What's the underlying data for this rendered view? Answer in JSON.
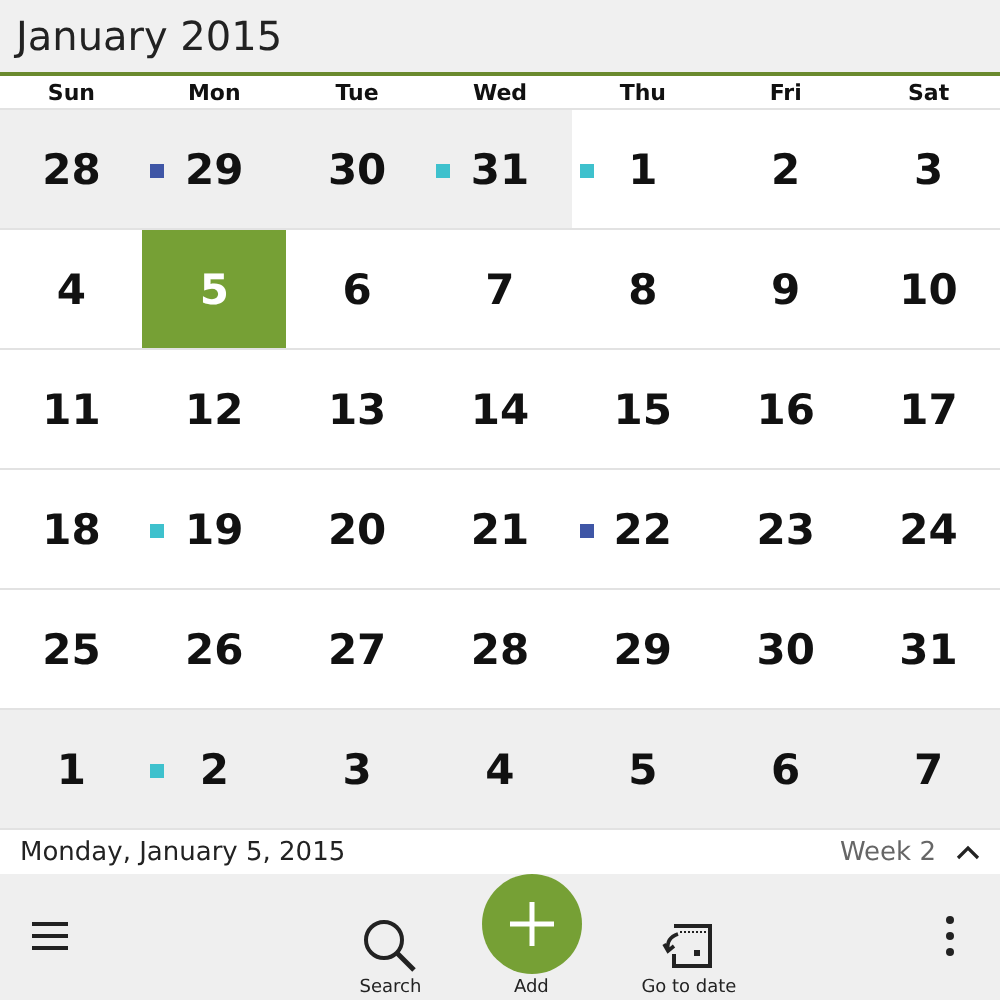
{
  "header": {
    "title": "January 2015"
  },
  "weekdays": [
    "Sun",
    "Mon",
    "Tue",
    "Wed",
    "Thu",
    "Fri",
    "Sat"
  ],
  "weeks": [
    [
      {
        "day": "28",
        "out_of_month": true,
        "selected": false
      },
      {
        "day": "29",
        "out_of_month": true,
        "selected": false,
        "color": "#3f56a6"
      },
      {
        "day": "30",
        "out_of_month": true,
        "selected": false
      },
      {
        "day": "31",
        "out_of_month": true,
        "selected": false,
        "color": "#3ec1cd"
      },
      {
        "day": "1",
        "out_of_month": false,
        "selected": false,
        "color": "#3ec1cd"
      },
      {
        "day": "2",
        "out_of_month": false,
        "selected": false
      },
      {
        "day": "3",
        "out_of_month": false,
        "selected": false
      }
    ],
    [
      {
        "day": "4",
        "out_of_month": false,
        "selected": false
      },
      {
        "day": "5",
        "out_of_month": false,
        "selected": true
      },
      {
        "day": "6",
        "out_of_month": false,
        "selected": false
      },
      {
        "day": "7",
        "out_of_month": false,
        "selected": false
      },
      {
        "day": "8",
        "out_of_month": false,
        "selected": false
      },
      {
        "day": "9",
        "out_of_month": false,
        "selected": false
      },
      {
        "day": "10",
        "out_of_month": false,
        "selected": false
      }
    ],
    [
      {
        "day": "11",
        "out_of_month": false,
        "selected": false
      },
      {
        "day": "12",
        "out_of_month": false,
        "selected": false
      },
      {
        "day": "13",
        "out_of_month": false,
        "selected": false
      },
      {
        "day": "14",
        "out_of_month": false,
        "selected": false
      },
      {
        "day": "15",
        "out_of_month": false,
        "selected": false
      },
      {
        "day": "16",
        "out_of_month": false,
        "selected": false
      },
      {
        "day": "17",
        "out_of_month": false,
        "selected": false
      }
    ],
    [
      {
        "day": "18",
        "out_of_month": false,
        "selected": false
      },
      {
        "day": "19",
        "out_of_month": false,
        "selected": false,
        "color": "#3ec1cd"
      },
      {
        "day": "20",
        "out_of_month": false,
        "selected": false
      },
      {
        "day": "21",
        "out_of_month": false,
        "selected": false
      },
      {
        "day": "22",
        "out_of_month": false,
        "selected": false,
        "color": "#3f56a6"
      },
      {
        "day": "23",
        "out_of_month": false,
        "selected": false
      },
      {
        "day": "24",
        "out_of_month": false,
        "selected": false
      }
    ],
    [
      {
        "day": "25",
        "out_of_month": false,
        "selected": false
      },
      {
        "day": "26",
        "out_of_month": false,
        "selected": false
      },
      {
        "day": "27",
        "out_of_month": false,
        "selected": false
      },
      {
        "day": "28",
        "out_of_month": false,
        "selected": false
      },
      {
        "day": "29",
        "out_of_month": false,
        "selected": false
      },
      {
        "day": "30",
        "out_of_month": false,
        "selected": false
      },
      {
        "day": "31",
        "out_of_month": false,
        "selected": false
      }
    ],
    [
      {
        "day": "1",
        "out_of_month": true,
        "selected": false
      },
      {
        "day": "2",
        "out_of_month": true,
        "selected": false,
        "color": "#3ec1cd"
      },
      {
        "day": "3",
        "out_of_month": true,
        "selected": false
      },
      {
        "day": "4",
        "out_of_month": true,
        "selected": false
      },
      {
        "day": "5",
        "out_of_month": true,
        "selected": false
      },
      {
        "day": "6",
        "out_of_month": true,
        "selected": false
      },
      {
        "day": "7",
        "out_of_month": true,
        "selected": false
      }
    ]
  ],
  "footer": {
    "date": "Monday, January 5, 2015",
    "week": "Week 2"
  },
  "toolbar": {
    "actions": [
      {
        "kind": "search",
        "label": "Search"
      },
      {
        "kind": "add",
        "label": "Add"
      },
      {
        "kind": "goto",
        "label": "Go to date"
      }
    ]
  }
}
